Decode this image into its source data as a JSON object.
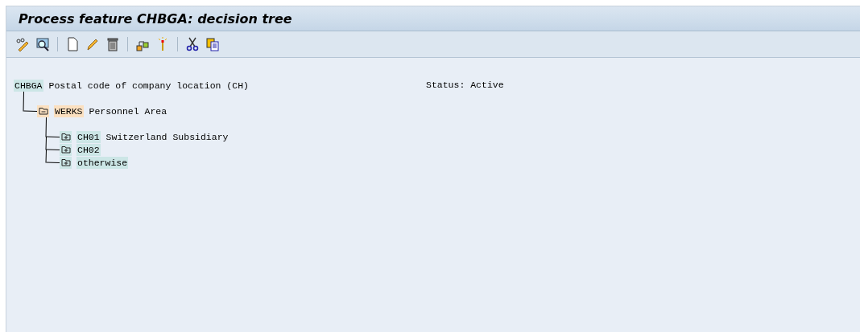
{
  "window": {
    "title": "Process feature CHBGA: decision tree"
  },
  "status": "Status: Active",
  "tree": {
    "key": "CHBGA",
    "text": "Postal code of company location (CH)",
    "kind": "feature",
    "children": [
      {
        "key": "WERKS",
        "text": "Personnel Area",
        "kind": "field",
        "expanded": true,
        "children": [
          {
            "key": "CH01",
            "text": "Switzerland Subsidiary",
            "kind": "value",
            "expanded": false
          },
          {
            "key": "CH02",
            "kind": "value",
            "expanded": false
          },
          {
            "key": "otherwise",
            "kind": "value",
            "expanded": false
          }
        ]
      }
    ]
  }
}
